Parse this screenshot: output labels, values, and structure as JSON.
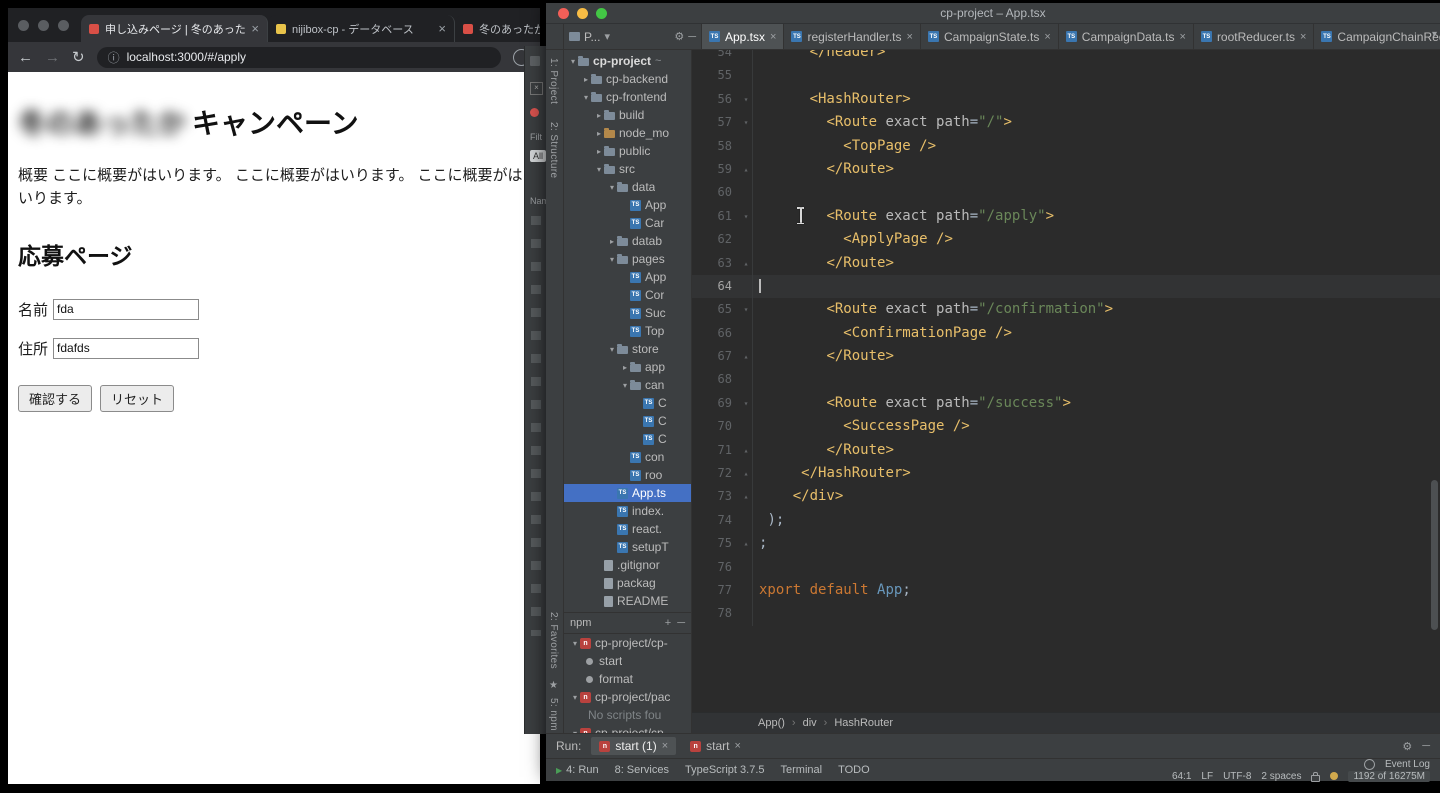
{
  "colors": {
    "selection": "#4470c4",
    "editor_bg": "#2b2b2b",
    "panel_bg": "#3c3f41",
    "tag": "#e8bf6a",
    "string": "#6a8759",
    "keyword": "#cc7832",
    "npm_red": "#b9423e"
  },
  "browser": {
    "tabs": [
      {
        "title": "申し込みページ | 冬のあった",
        "favicon": "#d94f46",
        "active": true
      },
      {
        "title": "nijibox-cp - データベース",
        "favicon": "#e8c34a",
        "active": false
      },
      {
        "title": "冬のあったか",
        "favicon": "#d94f46",
        "active": false
      }
    ],
    "toolbar": {
      "url": "localhost:3000/#/apply"
    },
    "page": {
      "title_blurred": "冬のあったか",
      "title": "キャンペーン",
      "intro": "概要 ここに概要がはいります。 ここに概要がはいります。 ここに概要がはいります。",
      "heading": "応募ページ",
      "fields": [
        {
          "label": "名前",
          "value": "fda"
        },
        {
          "label": "住所",
          "value": "fdafds"
        }
      ],
      "buttons": [
        {
          "label": "確認する"
        },
        {
          "label": "リセット"
        }
      ]
    }
  },
  "strip": {
    "labels": [
      "Filt",
      "All",
      "Nam"
    ]
  },
  "ide": {
    "title": "cp-project – App.tsx",
    "stripes": {
      "top": [
        "1: Project",
        "2: Structure"
      ],
      "bottom": [
        "2: Favorites",
        "5: npm"
      ]
    },
    "project_header": {
      "label": "P..."
    },
    "editor_tabs": [
      {
        "label": "App.tsx",
        "active": true
      },
      {
        "label": "registerHandler.ts",
        "active": false
      },
      {
        "label": "CampaignState.ts",
        "active": false
      },
      {
        "label": "CampaignData.ts",
        "active": false
      },
      {
        "label": "rootReducer.ts",
        "active": false
      },
      {
        "label": "CampaignChainReducer",
        "active": false
      }
    ],
    "tree": [
      {
        "d": 0,
        "k": "folder",
        "s": "open",
        "label": "cp-project",
        "suffix": "~",
        "bold": true
      },
      {
        "d": 1,
        "k": "folder",
        "s": "closed",
        "label": "cp-backend"
      },
      {
        "d": 1,
        "k": "folder",
        "s": "open",
        "label": "cp-frontend"
      },
      {
        "d": 2,
        "k": "folder",
        "s": "closed",
        "label": "build"
      },
      {
        "d": 2,
        "k": "folder",
        "s": "closed",
        "label": "node_mo",
        "mod": "excluded"
      },
      {
        "d": 2,
        "k": "folder",
        "s": "closed",
        "label": "public"
      },
      {
        "d": 2,
        "k": "folder",
        "s": "open",
        "label": "src"
      },
      {
        "d": 3,
        "k": "folder",
        "s": "open",
        "label": "data"
      },
      {
        "d": 4,
        "k": "file",
        "label": "App"
      },
      {
        "d": 4,
        "k": "file",
        "label": "Car"
      },
      {
        "d": 3,
        "k": "folder",
        "s": "closed",
        "label": "datab"
      },
      {
        "d": 3,
        "k": "folder",
        "s": "open",
        "label": "pages"
      },
      {
        "d": 4,
        "k": "file",
        "label": "App"
      },
      {
        "d": 4,
        "k": "file",
        "label": "Cor"
      },
      {
        "d": 4,
        "k": "file",
        "label": "Suc"
      },
      {
        "d": 4,
        "k": "file",
        "label": "Top"
      },
      {
        "d": 3,
        "k": "folder",
        "s": "open",
        "label": "store"
      },
      {
        "d": 4,
        "k": "folder",
        "s": "closed",
        "label": "app"
      },
      {
        "d": 4,
        "k": "folder",
        "s": "open",
        "label": "can"
      },
      {
        "d": 5,
        "k": "file",
        "label": "C"
      },
      {
        "d": 5,
        "k": "file",
        "label": "C"
      },
      {
        "d": 5,
        "k": "file",
        "label": "C"
      },
      {
        "d": 4,
        "k": "file",
        "label": "con"
      },
      {
        "d": 4,
        "k": "file",
        "label": "roo"
      },
      {
        "d": 3,
        "k": "file",
        "label": "App.ts",
        "selected": true
      },
      {
        "d": 3,
        "k": "file",
        "label": "index."
      },
      {
        "d": 3,
        "k": "file",
        "label": "react."
      },
      {
        "d": 3,
        "k": "file",
        "label": "setupT"
      },
      {
        "d": 2,
        "k": "file",
        "label": ".gitignor",
        "ic": "plain"
      },
      {
        "d": 2,
        "k": "file",
        "label": "packag",
        "ic": "plain"
      },
      {
        "d": 2,
        "k": "file",
        "label": "README",
        "ic": "plain"
      }
    ],
    "npm": {
      "title": "npm",
      "rows": [
        {
          "depth": 0,
          "icon": "npm",
          "arrow": true,
          "label": "cp-project/cp-"
        },
        {
          "depth": 1,
          "icon": "script",
          "label": "start"
        },
        {
          "depth": 1,
          "icon": "script",
          "label": "format"
        },
        {
          "depth": 0,
          "icon": "npm",
          "arrow": true,
          "label": "cp-project/pac"
        },
        {
          "depth": 1,
          "label": "No scripts fou",
          "muted": true
        },
        {
          "depth": 0,
          "icon": "npm",
          "arrow": true,
          "label": "cp-project/cp"
        }
      ]
    },
    "run": {
      "label": "Run:",
      "tabs": [
        {
          "label": "start (1)",
          "active": true
        },
        {
          "label": "start",
          "active": false
        }
      ]
    },
    "breadcrumbs": [
      "App()",
      "div",
      "HashRouter"
    ],
    "status": {
      "left": [
        "4: Run",
        "8: Services",
        "TypeScript 3.7.5",
        "Terminal",
        "TODO"
      ],
      "event_log": "Event Log",
      "caret": "64:1",
      "line_sep": "LF",
      "encoding": "UTF-8",
      "indent": "2 spaces",
      "memory": "1192 of 16275M"
    },
    "editor": {
      "lines": [
        {
          "n": 54,
          "i": 6,
          "seg": [
            [
              "tag",
              "</header>"
            ]
          ]
        },
        {
          "n": 55,
          "i": 0,
          "seg": []
        },
        {
          "n": 56,
          "i": 6,
          "seg": [
            [
              "tag",
              "<HashRouter>"
            ]
          ],
          "fold": "down"
        },
        {
          "n": 57,
          "i": 8,
          "seg": [
            [
              "tag",
              "<Route"
            ],
            [
              "attr",
              " exact path"
            ],
            [
              "plain",
              "="
            ],
            [
              "str",
              "\"/\""
            ],
            [
              "tag",
              ">"
            ]
          ],
          "fold": "down"
        },
        {
          "n": 58,
          "i": 10,
          "seg": [
            [
              "tag",
              "<TopPage />"
            ]
          ]
        },
        {
          "n": 59,
          "i": 8,
          "seg": [
            [
              "tag",
              "</Route>"
            ]
          ],
          "fold": "up"
        },
        {
          "n": 60,
          "i": 0,
          "seg": []
        },
        {
          "n": 61,
          "i": 8,
          "seg": [
            [
              "tag",
              "<Route"
            ],
            [
              "attr",
              " exact path"
            ],
            [
              "plain",
              "="
            ],
            [
              "str",
              "\"/apply\""
            ],
            [
              "tag",
              ">"
            ]
          ],
          "fold": "down"
        },
        {
          "n": 62,
          "i": 10,
          "seg": [
            [
              "tag",
              "<ApplyPage />"
            ]
          ]
        },
        {
          "n": 63,
          "i": 8,
          "seg": [
            [
              "tag",
              "</Route>"
            ]
          ],
          "fold": "up"
        },
        {
          "n": 64,
          "i": 0,
          "seg": [],
          "current": true
        },
        {
          "n": 65,
          "i": 8,
          "seg": [
            [
              "tag",
              "<Route"
            ],
            [
              "attr",
              " exact path"
            ],
            [
              "plain",
              "="
            ],
            [
              "str",
              "\"/confirmation\""
            ],
            [
              "tag",
              ">"
            ]
          ],
          "fold": "down"
        },
        {
          "n": 66,
          "i": 10,
          "seg": [
            [
              "tag",
              "<ConfirmationPage />"
            ]
          ]
        },
        {
          "n": 67,
          "i": 8,
          "seg": [
            [
              "tag",
              "</Route>"
            ]
          ],
          "fold": "up"
        },
        {
          "n": 68,
          "i": 0,
          "seg": []
        },
        {
          "n": 69,
          "i": 8,
          "seg": [
            [
              "tag",
              "<Route"
            ],
            [
              "attr",
              " exact path"
            ],
            [
              "plain",
              "="
            ],
            [
              "str",
              "\"/success\""
            ],
            [
              "tag",
              ">"
            ]
          ],
          "fold": "down"
        },
        {
          "n": 70,
          "i": 10,
          "seg": [
            [
              "tag",
              "<SuccessPage />"
            ]
          ]
        },
        {
          "n": 71,
          "i": 8,
          "seg": [
            [
              "tag",
              "</Route>"
            ]
          ],
          "fold": "up"
        },
        {
          "n": 72,
          "i": 5,
          "seg": [
            [
              "tag",
              "</HashRouter>"
            ]
          ],
          "fold": "up"
        },
        {
          "n": 73,
          "i": 4,
          "seg": [
            [
              "tag",
              "</div>"
            ]
          ],
          "fold": "up"
        },
        {
          "n": 74,
          "i": 1,
          "seg": [
            [
              "plain",
              ");"
            ]
          ]
        },
        {
          "n": 75,
          "i": 0,
          "seg": [
            [
              "plain",
              ";"
            ]
          ],
          "fold": "up"
        },
        {
          "n": 76,
          "i": 0,
          "seg": []
        },
        {
          "n": 77,
          "i": 0,
          "seg": [
            [
              "kw",
              "xport default "
            ],
            [
              "id",
              "App"
            ],
            [
              "plain",
              ";"
            ]
          ]
        },
        {
          "n": 78,
          "i": 0,
          "seg": []
        }
      ]
    }
  }
}
